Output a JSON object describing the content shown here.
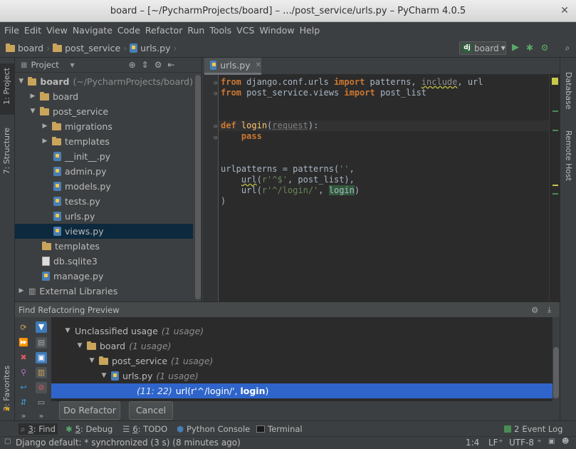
{
  "window": {
    "title": "board – [~/PycharmProjects/board] – .../post_service/urls.py – PyCharm 4.0.5",
    "close_glyph": "✕"
  },
  "menu": [
    "File",
    "Edit",
    "View",
    "Navigate",
    "Code",
    "Refactor",
    "Run",
    "Tools",
    "VCS",
    "Window",
    "Help"
  ],
  "breadcrumb": [
    "board",
    "post_service",
    "urls.py"
  ],
  "run_config": {
    "label": "board",
    "badge": "dj"
  },
  "left_tabs": {
    "project": "1: Project",
    "structure": "7: Structure",
    "favorites": "2: Favorites"
  },
  "right_tabs": {
    "database": "Database",
    "remote_host": "Remote Host"
  },
  "project": {
    "view_label": "Project",
    "tree": [
      {
        "label": "board",
        "suffix": "(~/PycharmProjects/board)"
      },
      {
        "label": "board"
      },
      {
        "label": "post_service"
      },
      {
        "label": "migrations"
      },
      {
        "label": "templates"
      },
      {
        "label": "__init__.py"
      },
      {
        "label": "admin.py"
      },
      {
        "label": "models.py"
      },
      {
        "label": "tests.py"
      },
      {
        "label": "urls.py"
      },
      {
        "label": "views.py"
      },
      {
        "label": "templates"
      },
      {
        "label": "db.sqlite3"
      },
      {
        "label": "manage.py"
      },
      {
        "label": "External Libraries"
      }
    ]
  },
  "editor": {
    "tab": "urls.py",
    "code": {
      "l1": {
        "k1": "from",
        "a": " django.conf.urls ",
        "k2": "import",
        "b": " patterns, ",
        "c": "include",
        "d": ", url"
      },
      "l2": {
        "k1": "from",
        "a": " post_service.views ",
        "k2": "import",
        "b": " post_list"
      },
      "l3": {
        "k1": "def",
        "sp": " ",
        "name": "login",
        "p1": "(",
        "param": "request",
        "p2": "):"
      },
      "l4": {
        "indent": "    ",
        "kw": "pass"
      },
      "l5": {
        "a": "urlpatterns = patterns(",
        "s": "''",
        "b": ","
      },
      "l6": {
        "indent": "    ",
        "fn": "url",
        "a": "(",
        "s": "r'^$'",
        "b": ", post_list),"
      },
      "l7": {
        "indent": "    ",
        "a": "url(",
        "s": "r'^/login/'",
        "b": ", ",
        "c": "login",
        "d": ")"
      },
      "l8": {
        "a": ")"
      }
    }
  },
  "find": {
    "title": "Find Refactoring Preview",
    "rows": {
      "unclassified": {
        "label": "Unclassified usage",
        "count": "(1 usage)"
      },
      "board": {
        "label": "board",
        "count": "(1 usage)"
      },
      "post_service": {
        "label": "post_service",
        "count": "(1 usage)"
      },
      "urls": {
        "label": "urls.py",
        "count": "(1 usage)"
      },
      "usage": {
        "pos": "(11: 22)",
        "text": "url(r'^/login/', ",
        "match": "login",
        "end": ")"
      }
    },
    "do_refactor": "Do Refactor",
    "cancel": "Cancel"
  },
  "tool_windows": [
    {
      "key": "3",
      "label": ": Find"
    },
    {
      "key": "5",
      "label": ": Debug"
    },
    {
      "key": "6",
      "label": ": TODO"
    },
    {
      "key": "",
      "label": "Python Console"
    },
    {
      "key": "",
      "label": "Terminal"
    }
  ],
  "event_log": {
    "count": "2",
    "label": "Event Log"
  },
  "status": {
    "message": "Django default: * synchronized (3 s) (8 minutes ago)",
    "position": "1:4",
    "line_sep": "LF",
    "encoding": "UTF-8"
  },
  "colors": {
    "accent_select": "#2f65ca",
    "tree_select": "#0d293e",
    "keyword": "#cc7832",
    "string": "#6a8759",
    "function": "#ffc66d"
  }
}
